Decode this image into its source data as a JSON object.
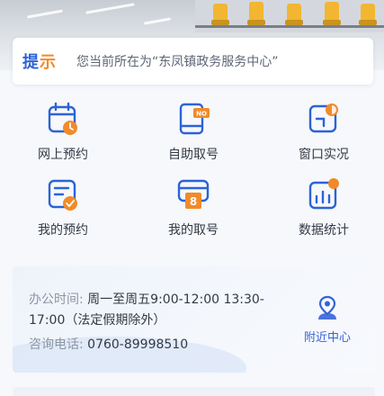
{
  "notice": {
    "title_part1": "提",
    "title_part2": "示",
    "text": "您当前所在为“东凤镇政务服务中心”"
  },
  "services": [
    {
      "label": "网上预约",
      "icon": "calendar-clock-icon"
    },
    {
      "label": "自助取号",
      "icon": "ticket-machine-icon"
    },
    {
      "label": "窗口实况",
      "icon": "window-live-icon"
    },
    {
      "label": "我的预约",
      "icon": "my-booking-icon"
    },
    {
      "label": "我的取号",
      "icon": "my-number-icon"
    },
    {
      "label": "数据统计",
      "icon": "bar-chart-icon"
    }
  ],
  "number_badge": "8",
  "ticket_badge": "NO",
  "info": {
    "hours_key": "办公时间:",
    "hours_line1": "周一至周五9:00-12:00 13:30-",
    "hours_line2": "17:00（法定假期除外）",
    "phone_key": "咨询电话:",
    "phone": "0760-89998510"
  },
  "nearby": {
    "label": "附近中心",
    "icon": "location-person-icon"
  },
  "colors": {
    "brand_blue": "#2c63d6",
    "accent_orange": "#f28a2a",
    "link_blue": "#3563d8"
  }
}
